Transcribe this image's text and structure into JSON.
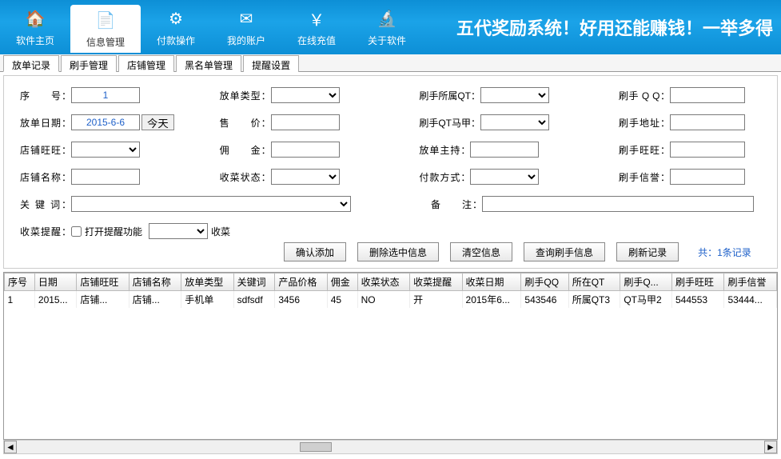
{
  "banner": {
    "title": "五代奖励系统！好用还能赚钱！一举多得",
    "buttons": [
      {
        "label": "软件主页",
        "icon": "🏠"
      },
      {
        "label": "信息管理",
        "icon": "📄"
      },
      {
        "label": "付款操作",
        "icon": "⚙"
      },
      {
        "label": "我的账户",
        "icon": "✉"
      },
      {
        "label": "在线充值",
        "icon": "￥"
      },
      {
        "label": "关于软件",
        "icon": "🔬"
      }
    ]
  },
  "tabs": [
    "放单记录",
    "刷手管理",
    "店铺管理",
    "黑名单管理",
    "提醒设置"
  ],
  "form": {
    "seq_label": "序　　号",
    "seq_value": "1",
    "date_label": "放单日期",
    "date_value": "2015-6-6",
    "today_btn": "今天",
    "shop_ww_label": "店铺旺旺",
    "shop_name_label": "店铺名称",
    "keyword_label": "关 键 词",
    "type_label": "放单类型",
    "price_label": "售　　价",
    "commission_label": "佣　　金",
    "status_label": "收菜状态",
    "qt_label": "刷手所属QT",
    "qt_ma_label": "刷手QT马甲",
    "host_label": "放单主持",
    "pay_label": "付款方式",
    "remark_label": "备　　注",
    "qq_label": "刷手 Q Q",
    "addr_label": "刷手地址",
    "ww_label": "刷手旺旺",
    "credit_label": "刷手信誉",
    "remind_label": "收菜提醒",
    "remind_check": "打开提醒功能",
    "remind_suffix": "收菜"
  },
  "actions": {
    "confirm": "确认添加",
    "delete": "删除选中信息",
    "clear": "清空信息",
    "query": "查询刷手信息",
    "refresh": "刷新记录",
    "count_prefix": "共：",
    "count_suffix": "条记录",
    "count": "1"
  },
  "grid": {
    "headers": [
      "序号",
      "日期",
      "店铺旺旺",
      "店铺名称",
      "放单类型",
      "关键词",
      "产品价格",
      "佣金",
      "收菜状态",
      "收菜提醒",
      "收菜日期",
      "刷手QQ",
      "所在QT",
      "刷手Q...",
      "刷手旺旺",
      "刷手信誉"
    ],
    "rows": [
      [
        "1",
        "2015...",
        "店铺...",
        "店铺...",
        "手机单",
        "sdfsdf",
        "3456",
        "45",
        "NO",
        "开",
        "2015年6...",
        "543546",
        "所属QT3",
        "QT马甲2",
        "544553",
        "53444..."
      ]
    ]
  }
}
